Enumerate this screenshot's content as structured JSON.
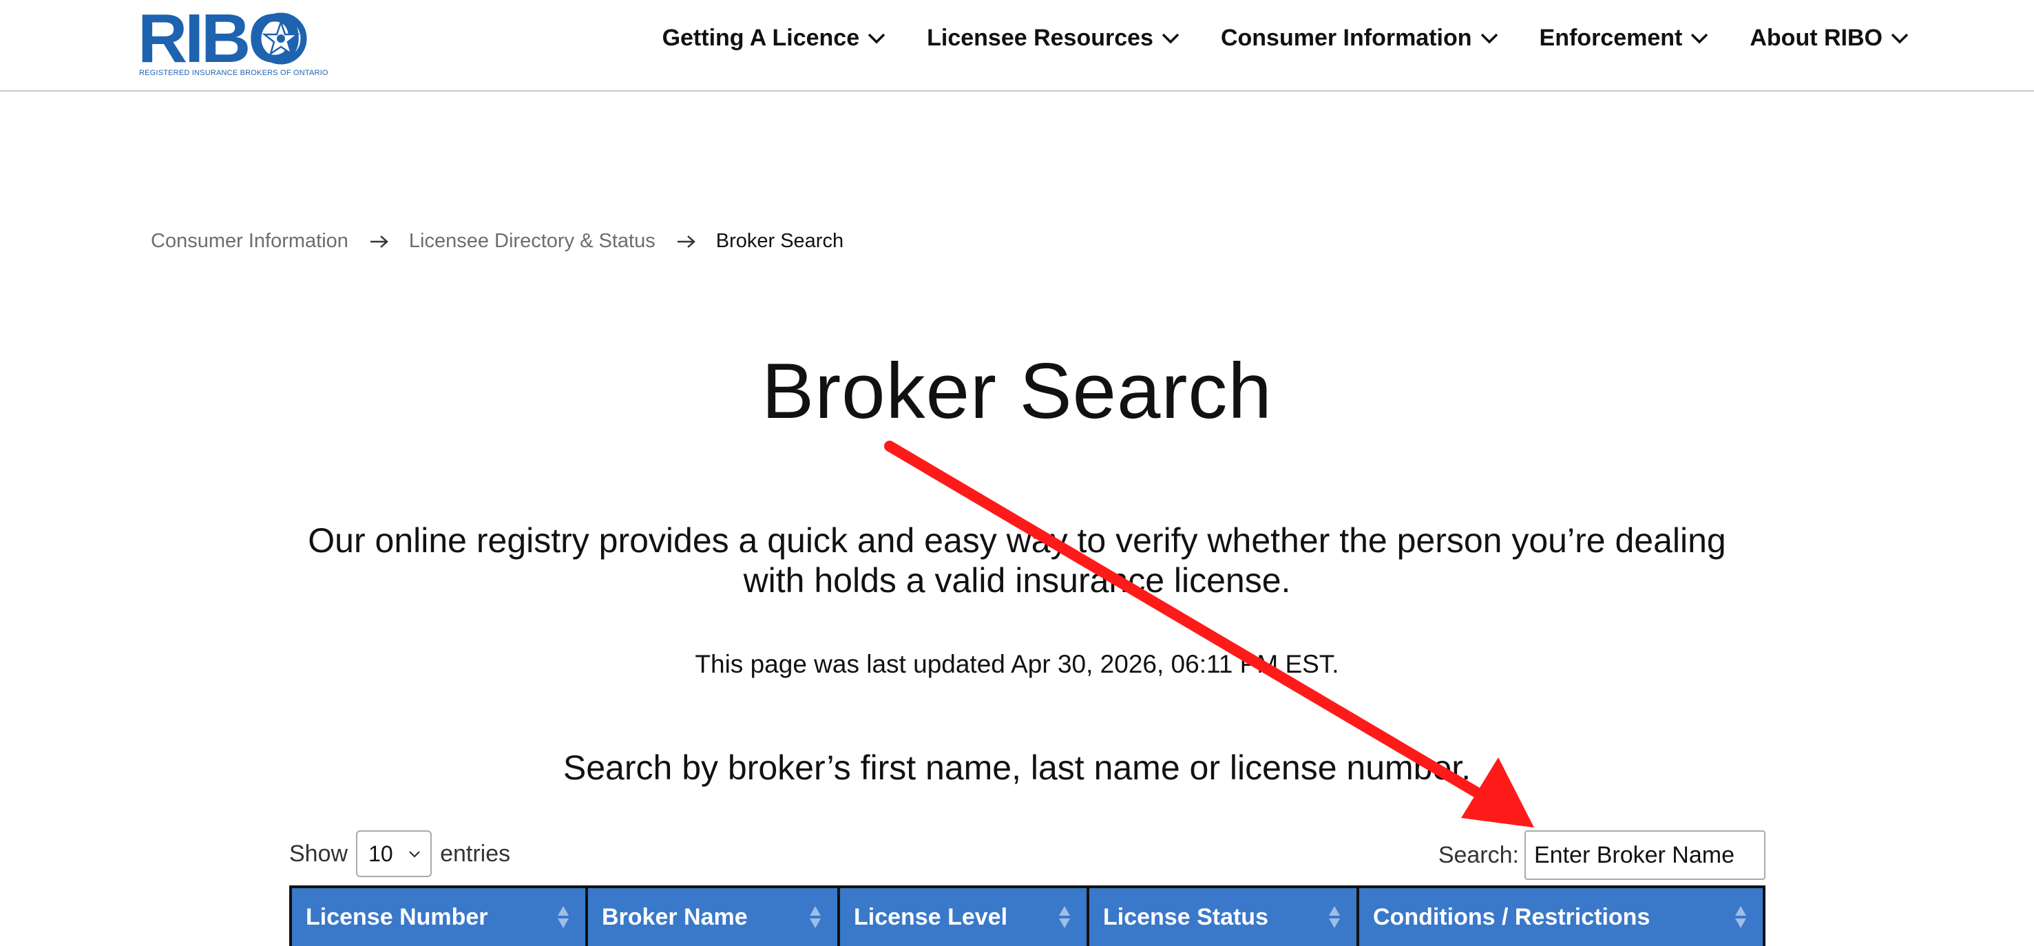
{
  "header": {
    "logo": {
      "wordmark": "RIBO",
      "subtitle": "Registered Insurance Brokers of Ontario"
    },
    "nav": [
      {
        "label": "Getting A Licence"
      },
      {
        "label": "Licensee Resources"
      },
      {
        "label": "Consumer Information"
      },
      {
        "label": "Enforcement"
      },
      {
        "label": "About RIBO"
      }
    ]
  },
  "breadcrumb": {
    "items": [
      "Consumer Information",
      "Licensee Directory & Status"
    ],
    "current": "Broker Search"
  },
  "main": {
    "title": "Broker Search",
    "intro": "Our online registry provides a quick and easy way to verify whether the person you’re dealing with holds a valid insurance license.",
    "last_updated": "This page was last updated Apr 30, 2026, 06:11 PM EST.",
    "search_hint": "Search by broker’s first name, last name or license number."
  },
  "table": {
    "length": {
      "show_label": "Show",
      "value": "10",
      "entries_label": "entries"
    },
    "search": {
      "label": "Search:",
      "placeholder": "Enter Broker Name"
    },
    "columns": [
      "License Number",
      "Broker Name",
      "License Level",
      "License Status",
      "Conditions / Restrictions"
    ]
  },
  "colors": {
    "brand": "#1e63b0",
    "table_header": "#3a78c9",
    "annotation": "#ff1a1a"
  },
  "icons": [
    "chevron-down-icon",
    "arrow-right-icon",
    "sort-icon",
    "logo-emblem-icon"
  ]
}
